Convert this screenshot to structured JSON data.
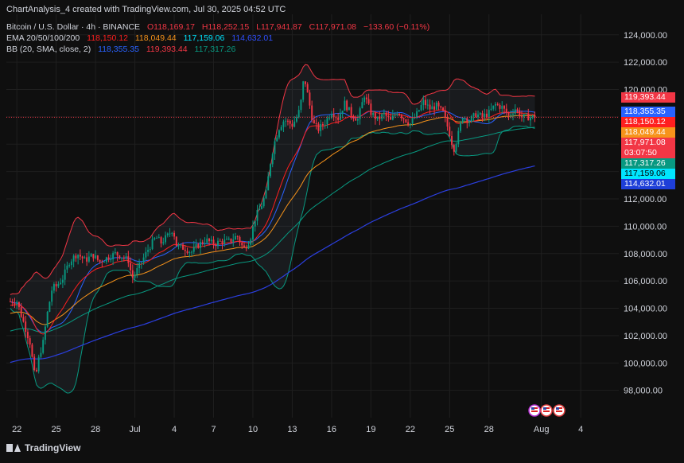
{
  "header": {
    "created": "ChartAnalysis_4 created with TradingView.com, Jul 30, 2025 04:52 UTC",
    "symbol": "Bitcoin / U.S. Dollar · 4h · BINANCE",
    "ohlc": {
      "open": "O118,169.17",
      "high": "H118,252.15",
      "low": "L117,941.87",
      "close": "C117,971.08",
      "change": "−133.60 (−0.11%)"
    },
    "ema": {
      "label": "EMA 20/50/100/200",
      "v20": "118,150.12",
      "v50": "118,049.44",
      "v100": "117,159.06",
      "v200": "114,632.01"
    },
    "bb": {
      "label": "BB (20, SMA, close, 2)",
      "basis": "118,355.35",
      "upper": "119,393.44",
      "lower": "117,317.26"
    }
  },
  "price_tags": [
    {
      "text": "119,393.44",
      "value": 119393.44,
      "bg": "#f23645",
      "fg": "#ffffff"
    },
    {
      "text": "118,355.35",
      "value": 118355.35,
      "bg": "#2962ff",
      "fg": "#ffffff"
    },
    {
      "text": "118,150.12",
      "value": 118150.12,
      "bg": "#ff1f1f",
      "fg": "#ffffff"
    },
    {
      "text": "118,049.44",
      "value": 118049.44,
      "bg": "#f7931a",
      "fg": "#ffffff"
    },
    {
      "text": "117,971.08",
      "value": 117971.08,
      "bg": "#f23645",
      "fg": "#ffffff"
    },
    {
      "text": "03:07:50",
      "value": 117971.08,
      "bg": "#f23645",
      "fg": "#ffffff"
    },
    {
      "text": "117,317.26",
      "value": 117317.26,
      "bg": "#089981",
      "fg": "#ffffff"
    },
    {
      "text": "117,159.06",
      "value": 117159.06,
      "bg": "#00e5ff",
      "fg": "#000000"
    },
    {
      "text": "114,632.01",
      "value": 114632.01,
      "bg": "#1e3fd8",
      "fg": "#ffffff"
    }
  ],
  "colors": {
    "background": "#0f0f0f",
    "grid": "#1f1f1f",
    "up": "#089981",
    "down": "#f23645",
    "ema20": "#ff1f1f",
    "ema50": "#f7931a",
    "ema100": "#00e5ff",
    "ema200": "#2b3fe0",
    "bb_basis": "#2962ff",
    "bb_upper": "#f23645",
    "bb_lower": "#089981",
    "bb_fill": "rgba(120,140,170,0.10)"
  },
  "footer": {
    "brand": "TradingView",
    "brand_icon": "tradingview-logo-icon",
    "event_icons": [
      "us-flag-icon",
      "us-flag-icon",
      "us-flag-icon"
    ]
  },
  "chart_data": {
    "type": "candlestick",
    "symbol": "Bitcoin / U.S. Dollar",
    "interval": "4h",
    "exchange": "BINANCE",
    "y_ticks": [
      98000,
      100000,
      102000,
      104000,
      106000,
      108000,
      110000,
      112000,
      114000,
      116000,
      118000,
      120000,
      122000,
      124000
    ],
    "y_tick_labels": [
      "98,000.00",
      "100,000.00",
      "102,000.00",
      "104,000.00",
      "106,000.00",
      "108,000.00",
      "110,000.00",
      "112,000.00",
      "114,000.00",
      "116,000.00",
      "118,000.00",
      "120,000.00",
      "122,000.00",
      "124,000.00"
    ],
    "ylim": [
      96000,
      125500
    ],
    "x_ticks": [
      {
        "label": "22",
        "day": 0
      },
      {
        "label": "25",
        "day": 3
      },
      {
        "label": "28",
        "day": 6
      },
      {
        "label": "Jul",
        "day": 9
      },
      {
        "label": "4",
        "day": 12
      },
      {
        "label": "7",
        "day": 15
      },
      {
        "label": "10",
        "day": 18
      },
      {
        "label": "13",
        "day": 21
      },
      {
        "label": "16",
        "day": 24
      },
      {
        "label": "19",
        "day": 27
      },
      {
        "label": "22",
        "day": 30
      },
      {
        "label": "25",
        "day": 33
      },
      {
        "label": "28",
        "day": 36
      },
      {
        "label": "Aug",
        "day": 40
      },
      {
        "label": "4",
        "day": 43
      }
    ],
    "xlim_days": [
      -0.8,
      45.9
    ],
    "last_price": 117971.08,
    "anchors": [
      [
        0,
        104500
      ],
      [
        0.5,
        103000
      ],
      [
        1,
        101500
      ],
      [
        1.4,
        98800
      ],
      [
        1.7,
        100500
      ],
      [
        2,
        101500
      ],
      [
        2.3,
        103500
      ],
      [
        2.7,
        105500
      ],
      [
        3,
        105600
      ],
      [
        3.5,
        106200
      ],
      [
        4,
        107400
      ],
      [
        4.6,
        108000
      ],
      [
        5.2,
        107500
      ],
      [
        5.8,
        107900
      ],
      [
        6.3,
        107400
      ],
      [
        6.9,
        107700
      ],
      [
        7.5,
        108000
      ],
      [
        8,
        107800
      ],
      [
        8.5,
        107500
      ],
      [
        8.8,
        106200
      ],
      [
        9,
        106500
      ],
      [
        9.4,
        107200
      ],
      [
        10,
        108300
      ],
      [
        10.6,
        109200
      ],
      [
        11,
        108800
      ],
      [
        11.5,
        109300
      ],
      [
        11.9,
        109800
      ],
      [
        12.2,
        108500
      ],
      [
        12.8,
        108400
      ],
      [
        13.3,
        108100
      ],
      [
        13.8,
        108600
      ],
      [
        14.4,
        109000
      ],
      [
        15,
        108700
      ],
      [
        15.6,
        108900
      ],
      [
        16.2,
        108900
      ],
      [
        16.8,
        109300
      ],
      [
        17.3,
        108300
      ],
      [
        17.8,
        109100
      ],
      [
        18.2,
        110700
      ],
      [
        18.6,
        111400
      ],
      [
        19,
        112400
      ],
      [
        19.3,
        114500
      ],
      [
        19.6,
        116000
      ],
      [
        20,
        117200
      ],
      [
        20.4,
        117800
      ],
      [
        21,
        117400
      ],
      [
        21.3,
        117900
      ],
      [
        21.6,
        118600
      ],
      [
        21.9,
        121000
      ],
      [
        22.2,
        119500
      ],
      [
        22.6,
        117500
      ],
      [
        23,
        117100
      ],
      [
        23.5,
        117600
      ],
      [
        24,
        118400
      ],
      [
        24.5,
        117900
      ],
      [
        25,
        119000
      ],
      [
        25.5,
        118200
      ],
      [
        26,
        117800
      ],
      [
        26.5,
        119600
      ],
      [
        27,
        118300
      ],
      [
        27.5,
        117800
      ],
      [
        28,
        118200
      ],
      [
        28.5,
        117700
      ],
      [
        29,
        118400
      ],
      [
        29.5,
        117900
      ],
      [
        30,
        117500
      ],
      [
        30.5,
        118200
      ],
      [
        31,
        119100
      ],
      [
        31.5,
        118600
      ],
      [
        32,
        118800
      ],
      [
        32.5,
        118300
      ],
      [
        33,
        116800
      ],
      [
        33.3,
        115600
      ],
      [
        33.6,
        116500
      ],
      [
        34,
        118100
      ],
      [
        34.5,
        117700
      ],
      [
        35,
        118200
      ],
      [
        35.5,
        118000
      ],
      [
        36,
        118300
      ],
      [
        36.5,
        118900
      ],
      [
        37,
        118700
      ],
      [
        37.5,
        118100
      ],
      [
        38,
        118600
      ],
      [
        38.5,
        118000
      ],
      [
        39.5,
        117971
      ]
    ],
    "series": [
      {
        "name": "EMA 20",
        "value": 118150.12
      },
      {
        "name": "EMA 50",
        "value": 118049.44
      },
      {
        "name": "EMA 100",
        "value": 117159.06
      },
      {
        "name": "EMA 200",
        "value": 114632.01
      },
      {
        "name": "BB basis",
        "value": 118355.35
      },
      {
        "name": "BB upper",
        "value": 119393.44
      },
      {
        "name": "BB lower",
        "value": 117317.26
      }
    ]
  }
}
